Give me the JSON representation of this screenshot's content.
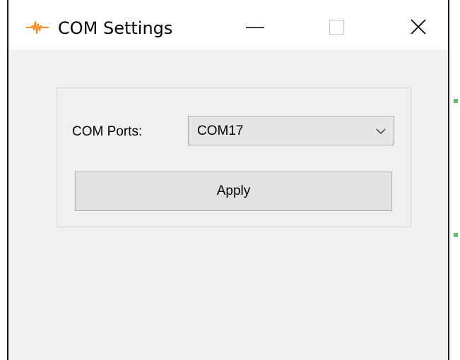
{
  "window": {
    "title": "COM Settings",
    "icon": "orange-waveform-icon",
    "accent_color": "#f5891f"
  },
  "titlebar_buttons": {
    "minimize": "minimize-icon",
    "maximize": "maximize-icon",
    "close": "close-icon"
  },
  "form": {
    "com_ports_label": "COM Ports:",
    "com_ports_value": "COM17",
    "dropdown_icon": "chevron-down-icon",
    "apply_label": "Apply"
  }
}
